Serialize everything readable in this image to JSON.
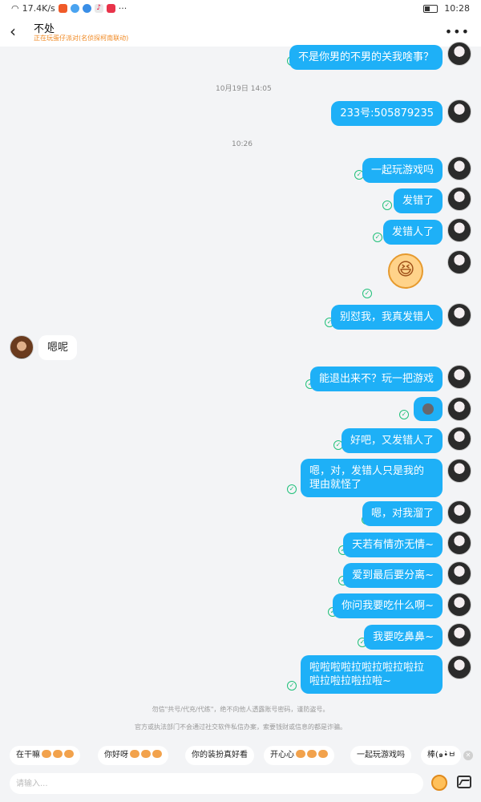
{
  "status_bar": {
    "net_speed": "17.4K/s",
    "time": "10:28"
  },
  "header": {
    "back": "‹",
    "title": "不处",
    "subtitle": "正在玩蛋仔派对(名侦探柯南联动)",
    "more": "•••"
  },
  "messages": [
    {
      "type": "out",
      "text": "不是你男的不男的关我啥事？"
    },
    {
      "type": "time",
      "text": "10月19日 14:05"
    },
    {
      "type": "out",
      "text": "233号:505879235"
    },
    {
      "type": "time",
      "text": "10:26"
    },
    {
      "type": "out",
      "text": "一起玩游戏吗"
    },
    {
      "type": "out",
      "text": "发错了"
    },
    {
      "type": "out",
      "text": "发错人了"
    },
    {
      "type": "out_sticker",
      "icon": "laughing-sticker"
    },
    {
      "type": "out",
      "text": "别怼我，我真发错人"
    },
    {
      "type": "in",
      "text": "嗯呢"
    },
    {
      "type": "out",
      "text": "能退出来不？玩一把游戏"
    },
    {
      "type": "out_emoji",
      "icon": "sad-emoji"
    },
    {
      "type": "out",
      "text": "好吧，又发错人了"
    },
    {
      "type": "out",
      "text": "嗯，对，发错人只是我的理由就怪了"
    },
    {
      "type": "out",
      "text": "嗯，对我溜了"
    },
    {
      "type": "out",
      "text": "天若有情亦无情~"
    },
    {
      "type": "out",
      "text": "爱到最后要分离~"
    },
    {
      "type": "out",
      "text": "你问我要吃什么啊~"
    },
    {
      "type": "out",
      "text": "我要吃鼻鼻~"
    },
    {
      "type": "out",
      "text": "啦啦啦啦拉啦拉啦拉啦拉啦拉啦拉啦拉啦~"
    }
  ],
  "notice": {
    "line1": "勿信\"共号/代充/代练\"，绝不向他人透露账号密码，谨防盗号。",
    "line2": "官方或执法部门不会通过社交软件私信办案，索要钱财或信息的都是诈骗。"
  },
  "quick_replies": [
    "在干嘛",
    "你好呀",
    "你的装扮真好看",
    "开心心",
    "一起玩游戏吗",
    "棒(๑•̀ㅂ"
  ],
  "input": {
    "placeholder": "请输入..."
  },
  "colors": {
    "bubble_out": "#1eb0f7",
    "bubble_in": "#ffffff",
    "check": "#21c07a",
    "subtitle": "#f08a24"
  }
}
